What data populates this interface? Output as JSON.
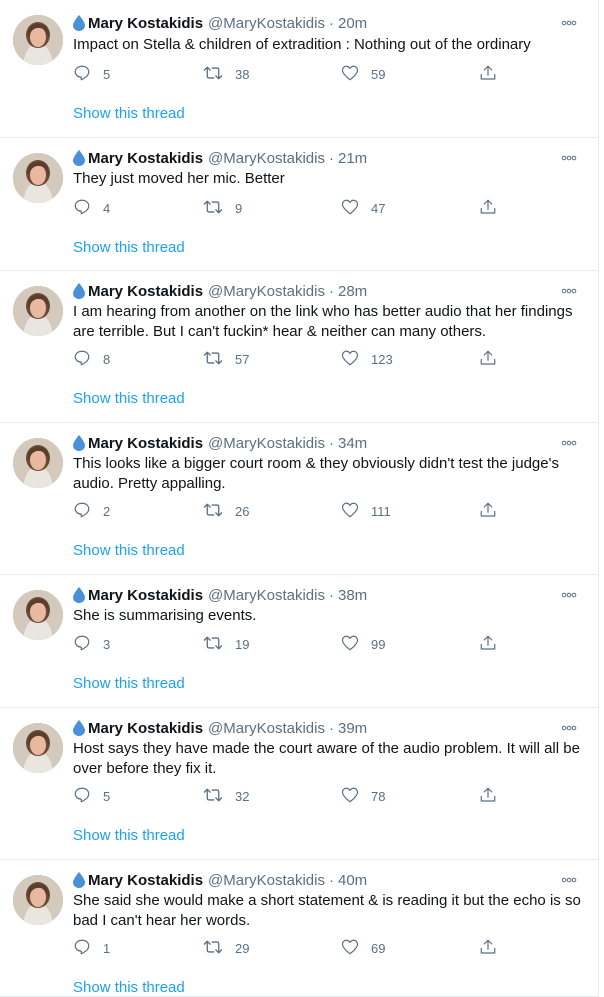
{
  "author": {
    "name": "Mary Kostakidis",
    "handle": "@MaryKostakidis"
  },
  "show_thread_label": "Show this thread",
  "tweets": [
    {
      "time": "20m",
      "text": "Impact on Stella & children of extradition : Nothing out of the ordinary",
      "replies": "5",
      "retweets": "38",
      "likes": "59"
    },
    {
      "time": "21m",
      "text": "They just moved her mic. Better",
      "replies": "4",
      "retweets": "9",
      "likes": "47"
    },
    {
      "time": "28m",
      "text": "I am hearing from another on the link who has better audio that her findings are terrible. But I can't fuckin* hear & neither can many others.",
      "replies": "8",
      "retweets": "57",
      "likes": "123"
    },
    {
      "time": "34m",
      "text": "This looks like a bigger court room & they obviously didn't test the judge's audio. Pretty appalling.",
      "replies": "2",
      "retweets": "26",
      "likes": "111"
    },
    {
      "time": "38m",
      "text": "She is summarising events.",
      "replies": "3",
      "retweets": "19",
      "likes": "99"
    },
    {
      "time": "39m",
      "text": "Host says they have made the court aware of the audio problem. It will all be over before they fix it.",
      "replies": "5",
      "retweets": "32",
      "likes": "78"
    },
    {
      "time": "40m",
      "text": "She said she would make a short statement & is reading it but the echo is so bad I can't hear her words.",
      "replies": "1",
      "retweets": "29",
      "likes": "69"
    }
  ],
  "colors": {
    "accent": "#1da1f2",
    "muted": "#5b7083",
    "drop": "#4a90d9"
  },
  "icons": [
    "droplet-icon",
    "more-icon",
    "reply-icon",
    "retweet-icon",
    "like-icon",
    "share-icon"
  ]
}
